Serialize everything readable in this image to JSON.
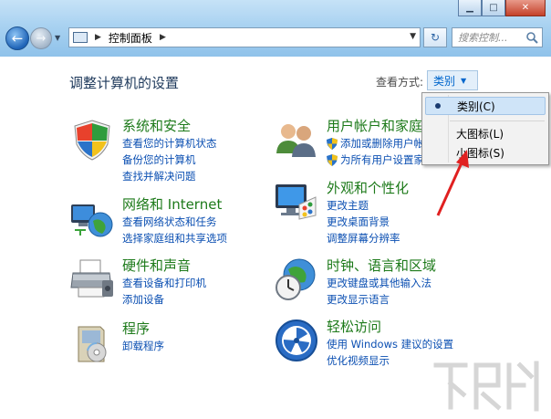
{
  "address_bar": {
    "path": "控制面板"
  },
  "search": {
    "placeholder": "搜索控制..."
  },
  "header": {
    "title": "调整计算机的设置",
    "view_by_label": "查看方式:",
    "view_by_value": "类别"
  },
  "categories": [
    {
      "title": "系统和安全",
      "icon": "shield-security-icon",
      "links": [
        "查看您的计算机状态",
        "备份您的计算机",
        "查找并解决问题"
      ]
    },
    {
      "title": "网络和 Internet",
      "icon": "network-globe-icon",
      "links": [
        "查看网络状态和任务",
        "选择家庭组和共享选项"
      ]
    },
    {
      "title": "硬件和声音",
      "icon": "printer-icon",
      "links": [
        "查看设备和打印机",
        "添加设备"
      ]
    },
    {
      "title": "程序",
      "icon": "programs-box-icon",
      "links": [
        "卸载程序"
      ]
    },
    {
      "title": "用户帐户和家庭",
      "icon": "users-icon",
      "links": [
        "添加或删除用户帐",
        "为所有用户设置家"
      ]
    },
    {
      "title": "外观和个性化",
      "icon": "monitor-palette-icon",
      "links": [
        "更改主题",
        "更改桌面背景",
        "调整屏幕分辨率"
      ]
    },
    {
      "title": "时钟、语言和区域",
      "icon": "clock-globe-icon",
      "links": [
        "更改键盘或其他输入法",
        "更改显示语言"
      ]
    },
    {
      "title": "轻松访问",
      "icon": "ease-of-access-icon",
      "links": [
        "使用 Windows 建议的设置",
        "优化视频显示"
      ]
    }
  ],
  "view_menu": {
    "items": [
      {
        "label": "类别(C)",
        "selected": true
      },
      {
        "label": "大图标(L)",
        "selected": false
      },
      {
        "label": "小图标(S)",
        "selected": false
      }
    ]
  },
  "colors": {
    "category_title": "#1d7a1a",
    "link": "#0b4fb2",
    "annotation_arrow": "#e02020"
  }
}
